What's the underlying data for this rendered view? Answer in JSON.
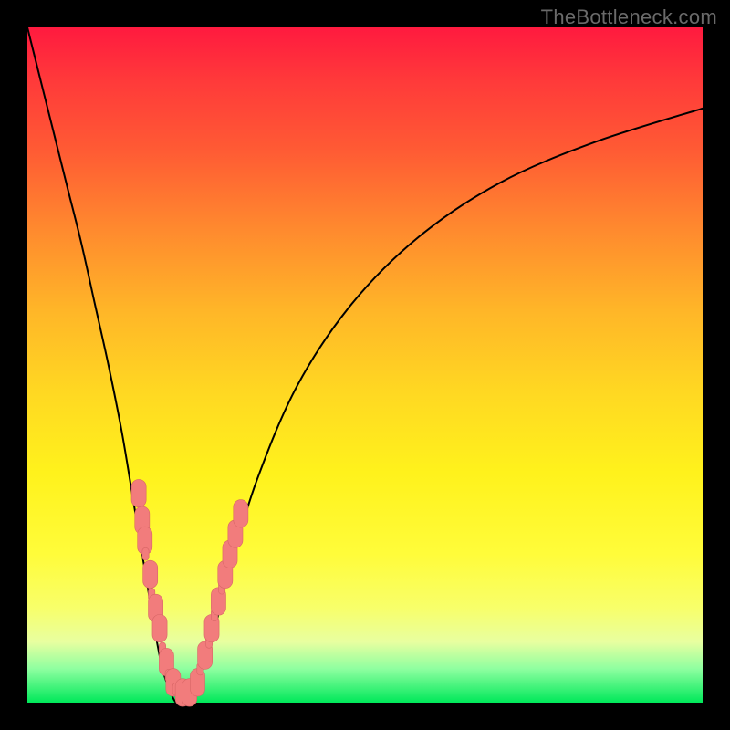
{
  "watermark": "TheBottleneck.com",
  "colors": {
    "frame": "#000000",
    "marker_fill": "#f27c7c",
    "marker_stroke": "#d86666",
    "curve": "#000000"
  },
  "chart_data": {
    "type": "line",
    "title": "",
    "xlabel": "",
    "ylabel": "",
    "xlim": [
      0,
      100
    ],
    "ylim": [
      0,
      100
    ],
    "grid": false,
    "legend": false,
    "series": [
      {
        "name": "left-curve",
        "x": [
          0,
          2,
          4,
          6,
          8,
          10,
          12,
          14,
          16,
          18,
          19,
          20,
          21,
          22,
          23
        ],
        "y": [
          100,
          92,
          84,
          76,
          68,
          59,
          50,
          40,
          28,
          16,
          10,
          5,
          2,
          0,
          0
        ]
      },
      {
        "name": "right-curve",
        "x": [
          24,
          26,
          28,
          30,
          34,
          40,
          48,
          58,
          70,
          84,
          100
        ],
        "y": [
          0,
          5,
          12,
          20,
          33,
          47,
          59,
          69,
          77,
          83,
          88
        ]
      }
    ],
    "markers": {
      "name": "pink-markers",
      "points": [
        {
          "x": 16.5,
          "y": 31,
          "r": 2.2
        },
        {
          "x": 17.0,
          "y": 27,
          "r": 2.2
        },
        {
          "x": 17.4,
          "y": 24,
          "r": 2.2
        },
        {
          "x": 17.5,
          "y": 22,
          "r": 1.0
        },
        {
          "x": 18.2,
          "y": 19,
          "r": 2.2
        },
        {
          "x": 18.4,
          "y": 16,
          "r": 1.0
        },
        {
          "x": 19.0,
          "y": 14,
          "r": 2.2
        },
        {
          "x": 19.6,
          "y": 11,
          "r": 2.2
        },
        {
          "x": 20.0,
          "y": 8,
          "r": 1.0
        },
        {
          "x": 20.6,
          "y": 6,
          "r": 2.2
        },
        {
          "x": 20.9,
          "y": 4,
          "r": 1.0
        },
        {
          "x": 21.6,
          "y": 3,
          "r": 2.2
        },
        {
          "x": 22.0,
          "y": 2,
          "r": 1.0
        },
        {
          "x": 23.0,
          "y": 1.5,
          "r": 2.2
        },
        {
          "x": 24.0,
          "y": 1.5,
          "r": 2.2
        },
        {
          "x": 25.2,
          "y": 3,
          "r": 2.2
        },
        {
          "x": 25.6,
          "y": 5,
          "r": 1.0
        },
        {
          "x": 26.3,
          "y": 7,
          "r": 2.2
        },
        {
          "x": 26.9,
          "y": 9,
          "r": 1.0
        },
        {
          "x": 27.3,
          "y": 11,
          "r": 2.2
        },
        {
          "x": 27.7,
          "y": 13,
          "r": 1.0
        },
        {
          "x": 28.3,
          "y": 15,
          "r": 2.2
        },
        {
          "x": 28.8,
          "y": 17,
          "r": 1.0
        },
        {
          "x": 29.3,
          "y": 19,
          "r": 2.2
        },
        {
          "x": 30.0,
          "y": 22,
          "r": 2.2
        },
        {
          "x": 30.8,
          "y": 25,
          "r": 2.2
        },
        {
          "x": 31.6,
          "y": 28,
          "r": 2.2
        }
      ]
    }
  }
}
